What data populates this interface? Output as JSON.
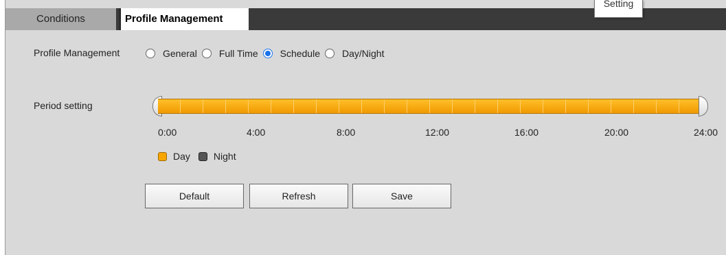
{
  "tabs": {
    "conditions": "Conditions",
    "profile_management": "Profile Management"
  },
  "tooltip": "Setting",
  "profile": {
    "label": "Profile Management",
    "options": [
      "General",
      "Full Time",
      "Schedule",
      "Day/Night"
    ],
    "selected": "Schedule"
  },
  "period": {
    "label": "Period setting",
    "ticks": [
      "0:00",
      "4:00",
      "8:00",
      "12:00",
      "16:00",
      "20:00",
      "24:00"
    ],
    "day_color": "#f7a600",
    "night_color": "#555555"
  },
  "legend": {
    "day": "Day",
    "night": "Night"
  },
  "buttons": {
    "default": "Default",
    "refresh": "Refresh",
    "save": "Save"
  }
}
